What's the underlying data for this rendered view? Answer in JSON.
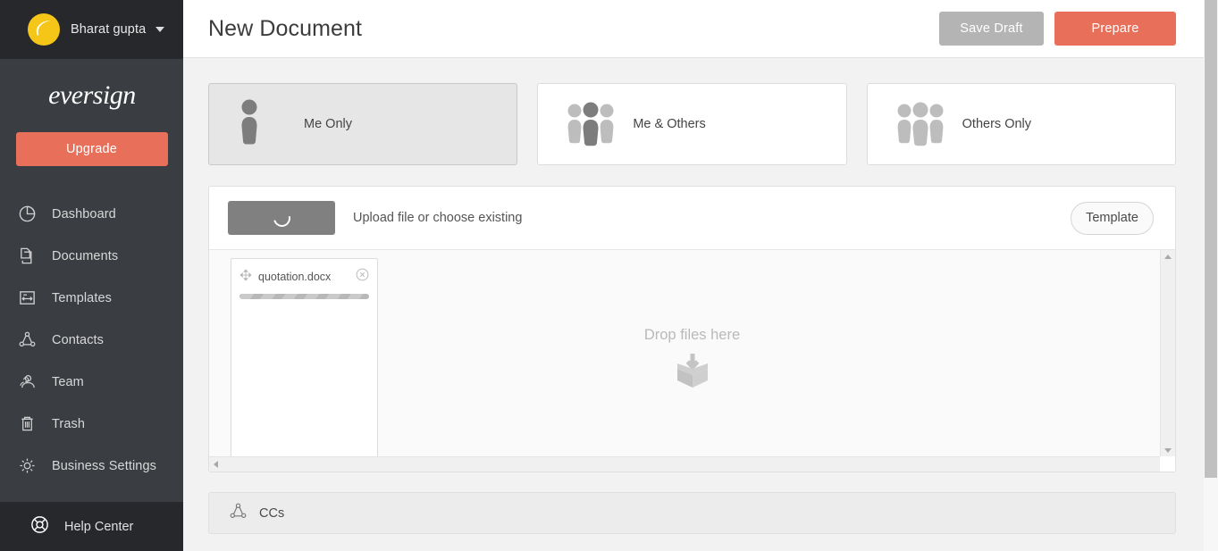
{
  "sidebar": {
    "user": {
      "name": "Bharat gupta",
      "avatar_icon": "leaf-icon",
      "caret_icon": "chevron-down-icon"
    },
    "brand": "eversign",
    "upgrade_label": "Upgrade",
    "items": [
      {
        "label": "Dashboard",
        "icon": "pie-chart-icon"
      },
      {
        "label": "Documents",
        "icon": "documents-icon"
      },
      {
        "label": "Templates",
        "icon": "templates-icon"
      },
      {
        "label": "Contacts",
        "icon": "contacts-icon"
      },
      {
        "label": "Team",
        "icon": "team-icon"
      },
      {
        "label": "Trash",
        "icon": "trash-icon"
      },
      {
        "label": "Business Settings",
        "icon": "gear-icon"
      }
    ],
    "help": {
      "label": "Help Center",
      "icon": "lifebuoy-icon"
    }
  },
  "topbar": {
    "title": "New Document",
    "save_draft_label": "Save Draft",
    "prepare_label": "Prepare"
  },
  "signer_options": [
    {
      "label": "Me Only",
      "icon": "single-person-icon",
      "selected": true
    },
    {
      "label": "Me & Others",
      "icon": "three-people-mixed-icon",
      "selected": false
    },
    {
      "label": "Others Only",
      "icon": "three-people-light-icon",
      "selected": false
    }
  ],
  "upload": {
    "button_icon": "loading-spinner-icon",
    "text": "Upload file or choose existing",
    "template_label": "Template",
    "drop_hint": "Drop files here",
    "drop_icon": "package-box-download-icon",
    "files": [
      {
        "name": "quotation.docx",
        "drag_icon": "move-handle-icon",
        "close_icon": "close-circle-icon",
        "progress": 100
      }
    ]
  },
  "ccs": {
    "label": "CCs",
    "icon": "contacts-icon"
  },
  "colors": {
    "accent": "#e8705a",
    "sidebar": "#3a3d42",
    "sidebar_dark": "#26282c",
    "avatar": "#f5c518",
    "draft_button": "#b4b4b4"
  }
}
